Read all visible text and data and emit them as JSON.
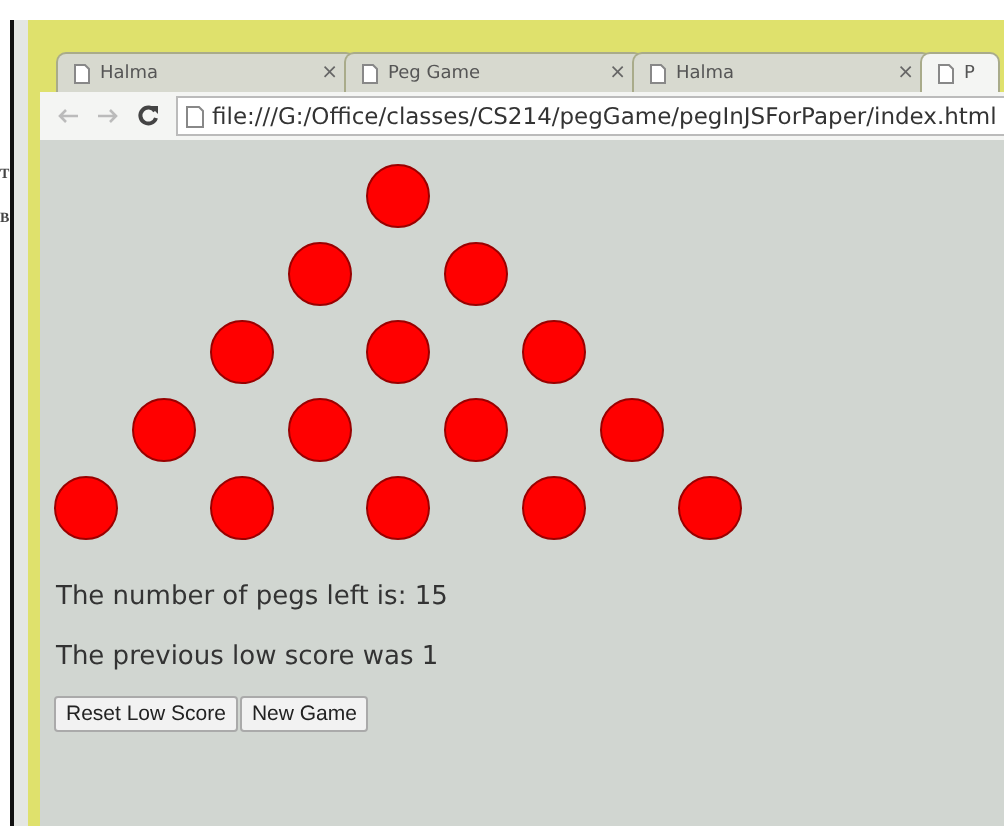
{
  "background_window": {
    "texts": [
      "T",
      "B"
    ]
  },
  "tabs": [
    {
      "title": "Halma",
      "close": "×",
      "selected": false
    },
    {
      "title": "Peg Game",
      "close": "×",
      "selected": false
    },
    {
      "title": "Halma",
      "close": "×",
      "selected": false
    },
    {
      "title": "P",
      "selected": true
    }
  ],
  "address_bar": {
    "url": "file:///G:/Office/classes/CS214/pegGame/pegInJSForPaper/index.html"
  },
  "board": {
    "rows": [
      [
        {
          "present": true
        }
      ],
      [
        {
          "present": true
        },
        {
          "present": true
        }
      ],
      [
        {
          "present": true
        },
        {
          "present": true
        },
        {
          "present": true
        }
      ],
      [
        {
          "present": true
        },
        {
          "present": true
        },
        {
          "present": true
        },
        {
          "present": true
        }
      ],
      [
        {
          "present": true
        },
        {
          "present": true
        },
        {
          "present": true
        },
        {
          "present": true
        },
        {
          "present": true
        }
      ]
    ]
  },
  "pegs_left": "The number of pegs left is: 15",
  "low_score": "The previous low score was 1",
  "buttons": [
    "Reset Low Score",
    "New Game"
  ]
}
